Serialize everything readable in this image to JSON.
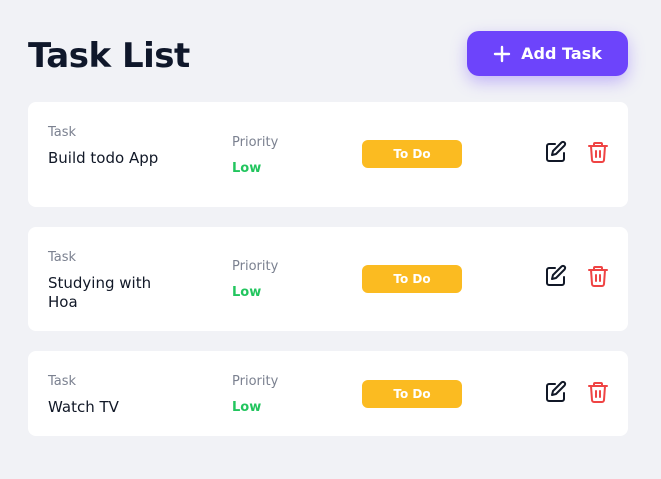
{
  "header": {
    "title": "Task List",
    "add_button_label": "Add Task"
  },
  "labels": {
    "task": "Task",
    "priority": "Priority"
  },
  "colors": {
    "accent": "#6d44fb",
    "priority_low": "#22c55e",
    "status_todo": "#fbbb21",
    "delete": "#ef4444"
  },
  "tasks": [
    {
      "name": "Build todo App",
      "priority": "Low",
      "status": "To Do"
    },
    {
      "name": "Studying with Hoa",
      "priority": "Low",
      "status": "To Do"
    },
    {
      "name": "Watch TV",
      "priority": "Low",
      "status": "To Do"
    }
  ],
  "icons": {
    "add": "plus-icon",
    "edit": "edit-icon",
    "delete": "trash-icon"
  }
}
